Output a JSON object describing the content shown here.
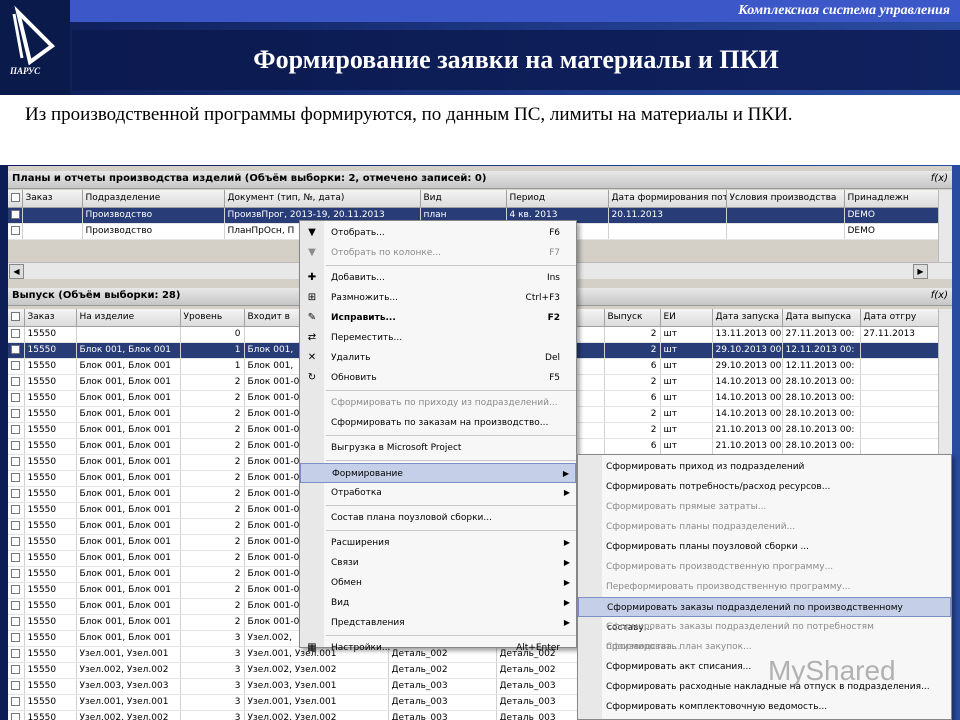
{
  "slide": {
    "system_label": "Комплексная система управления",
    "logo_text": "ПАРУС",
    "title": "Формирование заявки на материалы и ПКИ",
    "lead": "Из производственной программы формируются, по данным ПС, лимиты на материалы и ПКИ."
  },
  "top_panel": {
    "title": "Планы и отчеты производства изделий (Объём выборки: 2, отмечено записей: 0)",
    "fx": "f(x)",
    "headers": [
      "",
      "Заказ",
      "Подразделение",
      "Документ (тип, №, дата)",
      "Вид",
      "Период",
      "Дата формирования пот",
      "Условия производства",
      "Принадлежн"
    ],
    "rows": [
      {
        "selected": true,
        "cells": [
          "",
          "",
          "Производство",
          "ПроизвПрог, 2013-19, 20.11.2013",
          "план",
          "4 кв. 2013",
          "20.11.2013",
          "",
          "DEMO"
        ]
      },
      {
        "selected": false,
        "cells": [
          "",
          "",
          "Производство",
          "ПланПрОсн, П",
          "",
          "",
          "",
          "",
          "DEMO"
        ]
      }
    ]
  },
  "bottom_panel": {
    "title": "Выпуск (Объём выборки: 28)",
    "fx": "f(x)",
    "headers": [
      "",
      "Заказ",
      "На изделие",
      "Уровень",
      "Входит в",
      "",
      "",
      "Выпуск",
      "ЕИ",
      "Дата запуска",
      "Дата выпуска",
      "Дата отгру"
    ],
    "rows": [
      {
        "selected": false,
        "cells": [
          "",
          "15550",
          "",
          "0",
          "",
          "",
          "",
          "2",
          "шт",
          "13.11.2013 00",
          "27.11.2013 00:",
          "27.11.2013"
        ]
      },
      {
        "selected": true,
        "cells": [
          "",
          "15550",
          "Блок 001, Блок 001",
          "1",
          "Блок 001,",
          "",
          "",
          "2",
          "шт",
          "29.10.2013 00",
          "12.11.2013 00:",
          ""
        ]
      },
      {
        "selected": false,
        "cells": [
          "",
          "15550",
          "Блок 001, Блок 001",
          "1",
          "Блок 001,",
          "",
          "",
          "6",
          "шт",
          "29.10.2013 00",
          "12.11.2013 00:",
          ""
        ]
      },
      {
        "selected": false,
        "cells": [
          "",
          "15550",
          "Блок 001, Блок 001",
          "2",
          "Блок 001-0",
          "",
          "",
          "2",
          "шт",
          "14.10.2013 00",
          "28.10.2013 00:",
          ""
        ]
      },
      {
        "selected": false,
        "cells": [
          "",
          "15550",
          "Блок 001, Блок 001",
          "2",
          "Блок 001-0",
          "",
          "",
          "6",
          "шт",
          "14.10.2013 00",
          "28.10.2013 00:",
          ""
        ]
      },
      {
        "selected": false,
        "cells": [
          "",
          "15550",
          "Блок 001, Блок 001",
          "2",
          "Блок 001-0",
          "",
          "",
          "2",
          "шт",
          "14.10.2013 00",
          "28.10.2013 00:",
          ""
        ]
      },
      {
        "selected": false,
        "cells": [
          "",
          "15550",
          "Блок 001, Блок 001",
          "2",
          "Блок 001-0",
          "",
          "",
          "2",
          "шт",
          "21.10.2013 00",
          "28.10.2013 00:",
          ""
        ]
      },
      {
        "selected": false,
        "cells": [
          "",
          "15550",
          "Блок 001, Блок 001",
          "2",
          "Блок 001-0",
          "",
          "",
          "6",
          "шт",
          "21.10.2013 00",
          "28.10.2013 00:",
          ""
        ]
      },
      {
        "selected": false,
        "cells": [
          "",
          "15550",
          "Блок 001, Блок 001",
          "2",
          "Блок 001-0",
          "",
          "",
          "",
          "",
          "",
          "",
          ""
        ]
      },
      {
        "selected": false,
        "cells": [
          "",
          "15550",
          "Блок 001, Блок 001",
          "2",
          "Блок 001-0",
          "",
          "",
          "",
          "",
          "",
          "",
          ""
        ]
      },
      {
        "selected": false,
        "cells": [
          "",
          "15550",
          "Блок 001, Блок 001",
          "2",
          "Блок 001-0",
          "",
          "",
          "",
          "",
          "",
          "",
          ""
        ]
      },
      {
        "selected": false,
        "cells": [
          "",
          "15550",
          "Блок 001, Блок 001",
          "2",
          "Блок 001-0",
          "",
          "",
          "",
          "",
          "",
          "",
          ""
        ]
      },
      {
        "selected": false,
        "cells": [
          "",
          "15550",
          "Блок 001, Блок 001",
          "2",
          "Блок 001-0",
          "",
          "",
          "",
          "",
          "",
          "",
          ""
        ]
      },
      {
        "selected": false,
        "cells": [
          "",
          "15550",
          "Блок 001, Блок 001",
          "2",
          "Блок 001-0",
          "",
          "",
          "",
          "",
          "",
          "",
          ""
        ]
      },
      {
        "selected": false,
        "cells": [
          "",
          "15550",
          "Блок 001, Блок 001",
          "2",
          "Блок 001-0",
          "",
          "",
          "",
          "",
          "",
          "",
          ""
        ]
      },
      {
        "selected": false,
        "cells": [
          "",
          "15550",
          "Блок 001, Блок 001",
          "2",
          "Блок 001-0",
          "",
          "",
          "",
          "",
          "",
          "",
          ""
        ]
      },
      {
        "selected": false,
        "cells": [
          "",
          "15550",
          "Блок 001, Блок 001",
          "2",
          "Блок 001-0",
          "",
          "",
          "",
          "",
          "",
          "",
          ""
        ]
      },
      {
        "selected": false,
        "cells": [
          "",
          "15550",
          "Блок 001, Блок 001",
          "2",
          "Блок 001-0",
          "",
          "",
          "",
          "",
          "",
          "",
          ""
        ]
      },
      {
        "selected": false,
        "cells": [
          "",
          "15550",
          "Блок 001, Блок 001",
          "2",
          "Блок 001-0",
          "",
          "",
          "",
          "",
          "",
          "",
          ""
        ]
      },
      {
        "selected": false,
        "cells": [
          "",
          "15550",
          "Блок 001, Блок 001",
          "3",
          "Узел.002,",
          "",
          "",
          "",
          "",
          "",
          "",
          ""
        ]
      },
      {
        "selected": false,
        "cells": [
          "",
          "15550",
          "Узел.001, Узел.001",
          "3",
          "Узел.001, Узел.001",
          "Деталь_002",
          "Деталь_002",
          "",
          "",
          "",
          "",
          ""
        ]
      },
      {
        "selected": false,
        "cells": [
          "",
          "15550",
          "Узел.002, Узел.002",
          "3",
          "Узел.002, Узел.002",
          "Деталь_002",
          "Деталь_002",
          "",
          "",
          "",
          "",
          ""
        ]
      },
      {
        "selected": false,
        "cells": [
          "",
          "15550",
          "Узел.003, Узел.003",
          "3",
          "Узел.003, Узел.001",
          "Деталь_003",
          "Деталь_003",
          "",
          "",
          "",
          "",
          ""
        ]
      },
      {
        "selected": false,
        "cells": [
          "",
          "15550",
          "Узел.001, Узел.001",
          "3",
          "Узел.001, Узел.001",
          "Деталь_003",
          "Деталь_003",
          "",
          "",
          "",
          "",
          ""
        ]
      },
      {
        "selected": false,
        "cells": [
          "",
          "15550",
          "Узел.002, Узел.002",
          "3",
          "Узел.002, Узел.002",
          "Деталь_003",
          "Деталь_003",
          "",
          "",
          "",
          "",
          ""
        ]
      }
    ]
  },
  "context_menu": [
    {
      "label": "Отобрать...",
      "shortcut": "F6",
      "icon": "filter-icon",
      "glyph": "▼",
      "state": "normal"
    },
    {
      "label": "Отобрать по колонке...",
      "shortcut": "F7",
      "icon": "filter-column-icon",
      "glyph": "▼",
      "state": "disabled"
    },
    {
      "sep": true
    },
    {
      "label": "Добавить...",
      "shortcut": "Ins",
      "icon": "add-icon",
      "glyph": "✚",
      "state": "normal"
    },
    {
      "label": "Размножить...",
      "shortcut": "Ctrl+F3",
      "icon": "duplicate-icon",
      "glyph": "⊞",
      "state": "normal"
    },
    {
      "label": "Исправить...",
      "shortcut": "F2",
      "icon": "edit-icon",
      "glyph": "✎",
      "state": "bold"
    },
    {
      "label": "Переместить...",
      "shortcut": "",
      "icon": "move-icon",
      "glyph": "⇄",
      "state": "normal"
    },
    {
      "label": "Удалить",
      "shortcut": "Del",
      "icon": "delete-icon",
      "glyph": "✕",
      "state": "normal"
    },
    {
      "label": "Обновить",
      "shortcut": "F5",
      "icon": "refresh-icon",
      "glyph": "↻",
      "state": "normal"
    },
    {
      "sep": true
    },
    {
      "label": "Сформировать по приходу из подразделений...",
      "shortcut": "",
      "icon": "",
      "glyph": "",
      "state": "disabled"
    },
    {
      "label": "Сформировать по заказам на производство...",
      "shortcut": "",
      "icon": "",
      "glyph": "",
      "state": "normal"
    },
    {
      "sep": true
    },
    {
      "label": "Выгрузка в Microsoft Project",
      "shortcut": "",
      "icon": "",
      "glyph": "",
      "state": "normal"
    },
    {
      "sep": true
    },
    {
      "label": "Формирование",
      "shortcut": "",
      "icon": "",
      "glyph": "",
      "state": "highlight",
      "arrow": true
    },
    {
      "label": "Отработка",
      "shortcut": "",
      "icon": "",
      "glyph": "",
      "state": "normal",
      "arrow": true
    },
    {
      "sep": true
    },
    {
      "label": "Состав плана поузловой сборки...",
      "shortcut": "",
      "icon": "",
      "glyph": "",
      "state": "normal"
    },
    {
      "sep": true
    },
    {
      "label": "Расширения",
      "shortcut": "",
      "icon": "",
      "glyph": "",
      "state": "normal",
      "arrow": true
    },
    {
      "label": "Связи",
      "shortcut": "",
      "icon": "",
      "glyph": "",
      "state": "normal",
      "arrow": true
    },
    {
      "label": "Обмен",
      "shortcut": "",
      "icon": "",
      "glyph": "",
      "state": "normal",
      "arrow": true
    },
    {
      "label": "Вид",
      "shortcut": "",
      "icon": "",
      "glyph": "",
      "state": "normal",
      "arrow": true
    },
    {
      "label": "Представления",
      "shortcut": "",
      "icon": "",
      "glyph": "",
      "state": "normal",
      "arrow": true
    },
    {
      "sep": true
    },
    {
      "label": "Настройки...",
      "shortcut": "Alt+Enter",
      "icon": "settings-icon",
      "glyph": "▦",
      "state": "normal"
    }
  ],
  "submenu": [
    {
      "label": "Сформировать приход из подразделений",
      "state": "normal"
    },
    {
      "label": "Сформировать потребность/расход ресурсов...",
      "state": "normal"
    },
    {
      "label": "Сформировать прямые затраты...",
      "state": "disabled"
    },
    {
      "label": "Сформировать планы подразделений...",
      "state": "disabled"
    },
    {
      "label": "Сформировать планы поузловой сборки ...",
      "state": "normal"
    },
    {
      "label": "Сформировать производственную программу...",
      "state": "disabled"
    },
    {
      "label": "Переформировать производственную программу...",
      "state": "disabled"
    },
    {
      "label": "Сформировать заказы подразделений по производственному составу...",
      "state": "highlight"
    },
    {
      "label": "Сформировать заказы подразделений по потребностям производства...",
      "state": "disabled"
    },
    {
      "label": "Сформировать план закупок...",
      "state": "disabled"
    },
    {
      "label": "Сформировать акт списания...",
      "state": "normal"
    },
    {
      "label": "Сформировать расходные накладные на отпуск в подразделения...",
      "state": "normal"
    },
    {
      "label": "Сформировать комплектовочную ведомость...",
      "state": "normal"
    }
  ],
  "watermark": "MyShared",
  "colors": {
    "accent": "#283c78",
    "highlight": "#c5cfe8",
    "title_bg": "#0b1a4f",
    "topbar": "#3b57c8"
  }
}
